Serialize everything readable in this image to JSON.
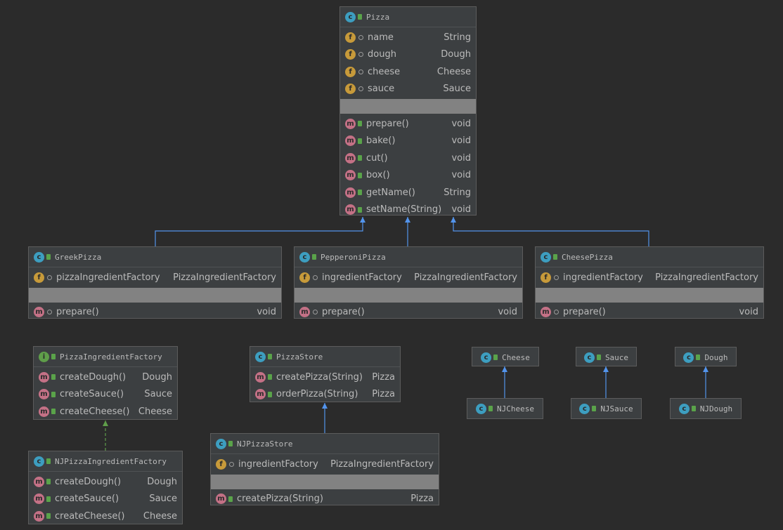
{
  "pizza": {
    "title": "Pizza",
    "fields": [
      {
        "name": "name",
        "type": "String"
      },
      {
        "name": "dough",
        "type": "Dough"
      },
      {
        "name": "cheese",
        "type": "Cheese"
      },
      {
        "name": "sauce",
        "type": "Sauce"
      }
    ],
    "methods": [
      {
        "name": "prepare()",
        "type": "void"
      },
      {
        "name": "bake()",
        "type": "void"
      },
      {
        "name": "cut()",
        "type": "void"
      },
      {
        "name": "box()",
        "type": "void"
      },
      {
        "name": "getName()",
        "type": "String"
      },
      {
        "name": "setName(String)",
        "type": "void"
      }
    ]
  },
  "greek_pizza": {
    "title": "GreekPizza",
    "fields": [
      {
        "name": "pizzaIngredientFactory",
        "type": "PizzaIngredientFactory"
      }
    ],
    "methods": [
      {
        "name": "prepare()",
        "type": "void"
      }
    ]
  },
  "pepperoni_pizza": {
    "title": "PepperoniPizza",
    "fields": [
      {
        "name": "ingredientFactory",
        "type": "PizzaIngredientFactory"
      }
    ],
    "methods": [
      {
        "name": "prepare()",
        "type": "void"
      }
    ]
  },
  "cheese_pizza": {
    "title": "CheesePizza",
    "fields": [
      {
        "name": "ingredientFactory",
        "type": "PizzaIngredientFactory"
      }
    ],
    "methods": [
      {
        "name": "prepare()",
        "type": "void"
      }
    ]
  },
  "pizza_ingredient_factory": {
    "title": "PizzaIngredientFactory",
    "methods": [
      {
        "name": "createDough()",
        "type": "Dough"
      },
      {
        "name": "createSauce()",
        "type": "Sauce"
      },
      {
        "name": "createCheese()",
        "type": "Cheese"
      }
    ]
  },
  "nj_pizza_ingredient_factory": {
    "title": "NJPizzaIngredientFactory",
    "methods": [
      {
        "name": "createDough()",
        "type": "Dough"
      },
      {
        "name": "createSauce()",
        "type": "Sauce"
      },
      {
        "name": "createCheese()",
        "type": "Cheese"
      }
    ]
  },
  "pizza_store": {
    "title": "PizzaStore",
    "methods": [
      {
        "name": "createPizza(String)",
        "type": "Pizza"
      },
      {
        "name": "orderPizza(String)",
        "type": "Pizza"
      }
    ]
  },
  "nj_pizza_store": {
    "title": "NJPizzaStore",
    "fields": [
      {
        "name": "ingredientFactory",
        "type": "PizzaIngredientFactory"
      }
    ],
    "methods": [
      {
        "name": "createPizza(String)",
        "type": "Pizza"
      }
    ]
  },
  "cheese": {
    "title": "Cheese"
  },
  "nj_cheese": {
    "title": "NJCheese"
  },
  "sauce": {
    "title": "Sauce"
  },
  "nj_sauce": {
    "title": "NJSauce"
  },
  "dough": {
    "title": "Dough"
  },
  "nj_dough": {
    "title": "NJDough"
  },
  "icons": {
    "class": "c",
    "interface": "i",
    "field": "f",
    "method": "m"
  },
  "colors": {
    "background": "#2b2b2b",
    "box": "#3c3f41",
    "extends_arrow": "#5394ec",
    "implements_arrow": "#5f9e4a",
    "class_icon": "#3d9ec0",
    "interface_icon": "#5f9e4a",
    "field_icon": "#c79a3a",
    "method_icon": "#c47186"
  }
}
